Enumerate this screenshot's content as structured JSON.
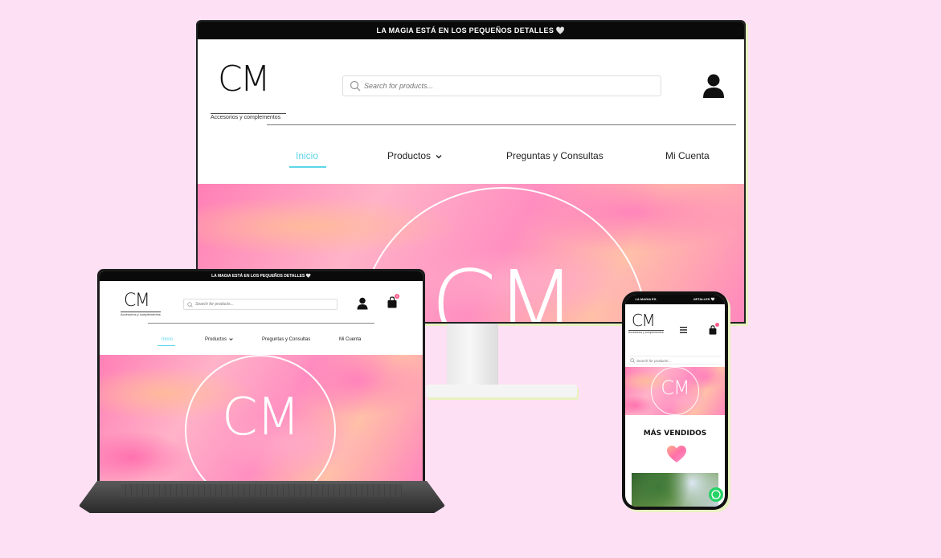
{
  "brand": {
    "logo_text": "CM",
    "logo_subtitle": "Accesorios y complementos"
  },
  "announcement": "LA MAGIA ESTÁ EN LOS PEQUEÑOS DETALLES 🤍",
  "search": {
    "placeholder": "Search for products..."
  },
  "nav": {
    "items": [
      {
        "label": "Inicio"
      },
      {
        "label": "Productos"
      },
      {
        "label": "Preguntas y Consultas"
      },
      {
        "label": "Mi Cuenta"
      }
    ]
  },
  "hero": {
    "logo_text": "CM"
  },
  "cart": {
    "badge_count": "0"
  },
  "mobile": {
    "section_title": "MÁS VENDIDOS"
  },
  "colors": {
    "background": "#fde0f3",
    "accent": "#5fd6e8",
    "topbar": "#0a0a0a",
    "whatsapp": "#25d366"
  },
  "icons": [
    "search-icon",
    "user-icon",
    "chevron-down-icon",
    "shopping-bag-icon",
    "hamburger-menu-icon",
    "heart-icon",
    "whatsapp-icon"
  ]
}
